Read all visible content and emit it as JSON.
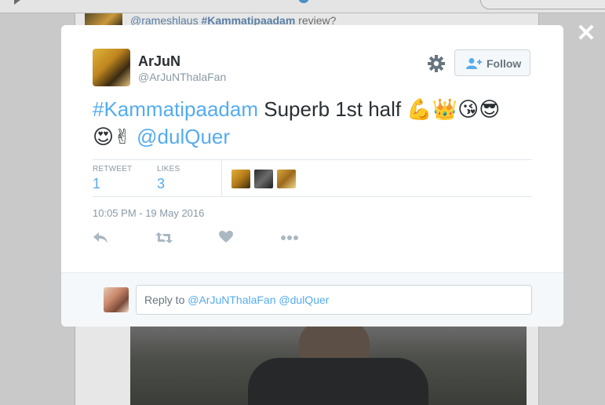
{
  "background": {
    "tweet": {
      "mention": "@rameshlaus",
      "hashtag": "#Kammatipaadam",
      "text": " review?"
    }
  },
  "modal": {
    "author": {
      "name": "ArJuN",
      "handle": "@ArJuNThalaFan"
    },
    "follow_label": "Follow",
    "tweet": {
      "hashtag": "#Kammatipaadam",
      "text": " Superb 1st half ",
      "emojis1": "💪👑😘😎",
      "emojis2": "😍✌",
      "mention": "@dulQuer"
    },
    "stats": {
      "retweets_label": "RETWEET",
      "retweets": "1",
      "likes_label": "LIKES",
      "likes": "3"
    },
    "timestamp": "10:05 PM - 19 May 2016",
    "reply": {
      "prefix": "Reply to ",
      "mention1": "@ArJuNThalaFan",
      "mention2": "@dulQuer"
    }
  },
  "colors": {
    "accent": "#55acee",
    "text": "#292f33",
    "muted": "#8899a6"
  },
  "icons": [
    "close-icon",
    "gear-icon",
    "follow-person-icon",
    "reply-icon",
    "retweet-icon",
    "heart-icon",
    "more-icon"
  ]
}
